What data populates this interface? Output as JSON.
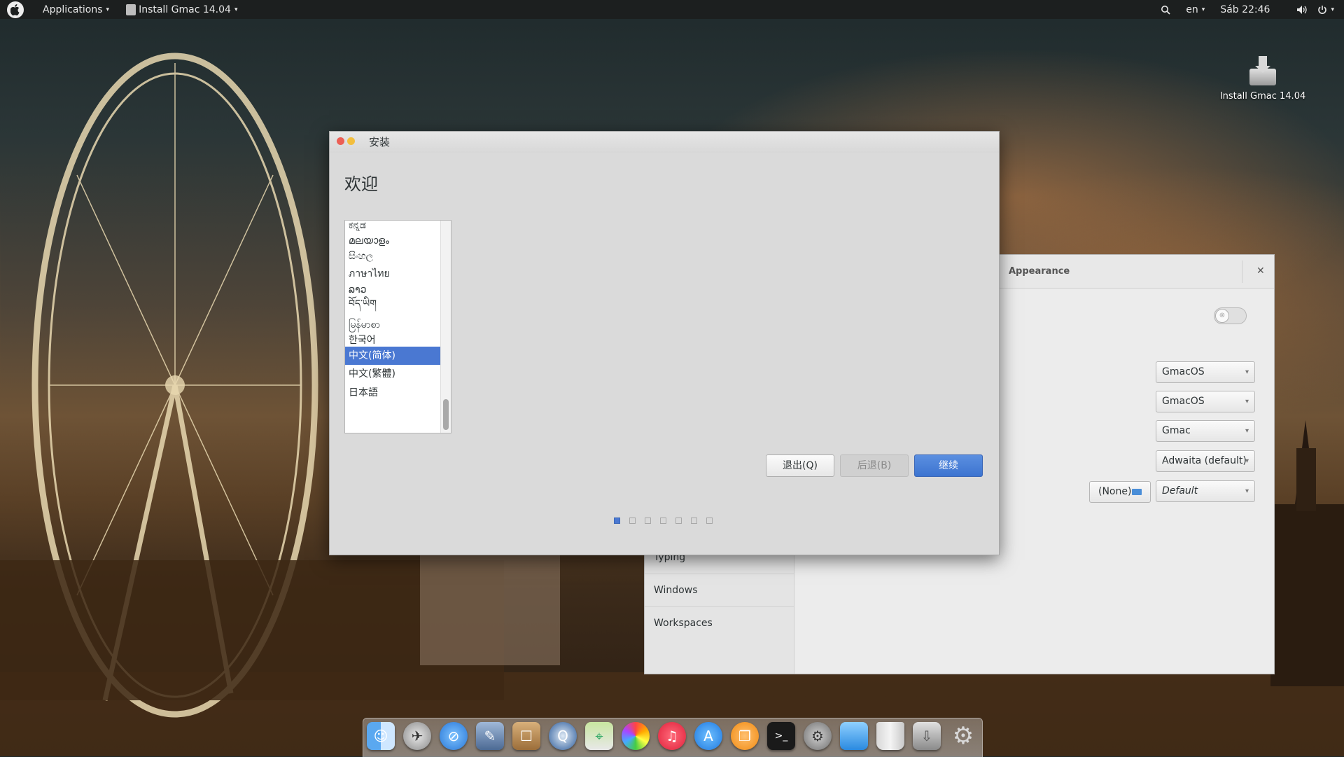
{
  "topbar": {
    "apple_icon": "apple-logo-icon",
    "applications_label": "Applications",
    "window_menu_label": "Install Gmac 14.04",
    "search_icon": "magnifier-icon",
    "keyboard_layout": "en",
    "clock": "Sáb 22:46",
    "volume_icon": "speaker-icon",
    "power_icon": "power-icon"
  },
  "desktop": {
    "icon_label": "Install Gmac 14.04",
    "icon": "installer-drive-icon"
  },
  "installer": {
    "title": "安装",
    "heading": "欢迎",
    "languages": [
      {
        "label": "ಕನ್ನಡ",
        "selected": false
      },
      {
        "label": "മലയാളം",
        "selected": false
      },
      {
        "label": "සිංහල",
        "selected": false
      },
      {
        "label": "ภาษาไทย",
        "selected": false
      },
      {
        "label": "ລາວ",
        "selected": false
      },
      {
        "label": "བོད་ཡིག",
        "selected": false
      },
      {
        "label": "မြန်မာစာ",
        "selected": false
      },
      {
        "label": "한국어",
        "selected": false
      },
      {
        "label": "中文(简体)",
        "selected": true
      },
      {
        "label": "中文(繁體)",
        "selected": false
      },
      {
        "label": "日本語",
        "selected": false
      }
    ],
    "quit_label": "退出(Q)",
    "back_label": "后退(B)",
    "next_label": "继续",
    "step_current": 1,
    "step_total": 7,
    "colors": {
      "selection": "#4a78d2",
      "close": "#ec5f55",
      "minimize": "#f3be3d"
    }
  },
  "tweak": {
    "title": "Appearance",
    "close_icon": "close-x-icon",
    "toggle_on": false,
    "sidebar": [
      "Typing",
      "Windows",
      "Workspaces"
    ],
    "selects": [
      "GmacOS",
      "GmacOS",
      "Gmac",
      "Adwaita (default)",
      "Default"
    ],
    "font_button_label": "(None)"
  },
  "dock": {
    "icons": [
      "finder-icon",
      "launchpad-rocket-icon",
      "safari-compass-icon",
      "preview-icon",
      "contacts-book-icon",
      "quicktime-icon",
      "maps-icon",
      "photos-icon",
      "itunes-icon",
      "app-store-icon",
      "ibooks-icon",
      "terminal-icon",
      "system-preferences-icon",
      "files-icon",
      "trash-icon",
      "installer-drive-icon",
      "settings-gear-icon"
    ]
  }
}
